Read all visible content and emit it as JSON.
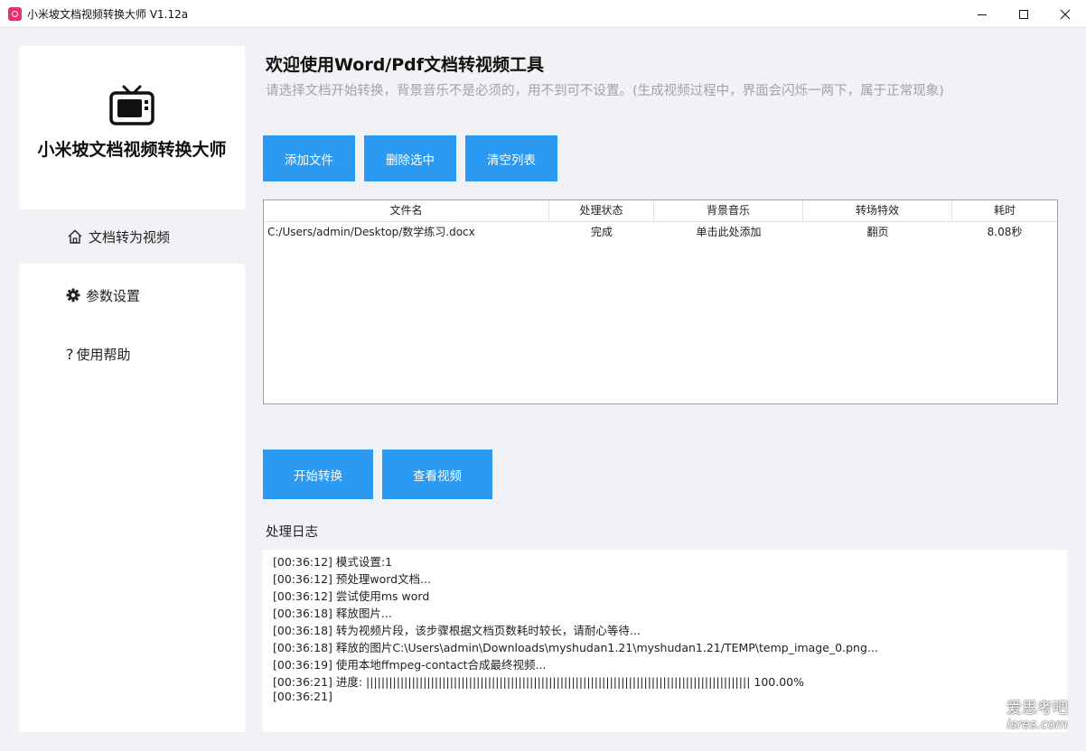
{
  "window": {
    "title": "小米坡文档视频转换大师 V1.12a"
  },
  "sidebar": {
    "app_name": "小米坡文档视频转换大师",
    "items": [
      {
        "label": "文档转为视频",
        "icon": "home-icon",
        "active": true
      },
      {
        "label": "参数设置",
        "icon": "gear-icon",
        "active": false
      },
      {
        "label": "使用帮助",
        "icon": "question-icon",
        "active": false
      }
    ]
  },
  "main": {
    "title": "欢迎使用Word/Pdf文档转视频工具",
    "subtitle": "请选择文档开始转换，背景音乐不是必须的，用不到可不设置。(生成视频过程中，界面会闪烁一两下，属于正常现象)",
    "buttons": {
      "add_file": "添加文件",
      "delete_selected": "删除选中",
      "clear_list": "清空列表",
      "start_convert": "开始转换",
      "view_video": "查看视频"
    },
    "table": {
      "headers": [
        "文件名",
        "处理状态",
        "背景音乐",
        "转场特效",
        "耗时"
      ],
      "rows": [
        [
          "C:/Users/admin/Desktop/数学练习.docx",
          "完成",
          "单击此处添加",
          "翻页",
          "8.08秒"
        ]
      ]
    },
    "log": {
      "label": "处理日志",
      "lines": [
        "[00:36:12] 模式设置:1",
        "[00:36:12] 预处理word文档...",
        "[00:36:12] 尝试使用ms word",
        "[00:36:18] 释放图片...",
        "[00:36:18] 转为视频片段，该步骤根据文档页数耗时较长，请耐心等待...",
        "[00:36:18] 释放的图片C:\\Users\\admin\\Downloads\\myshudan1.21\\myshudan1.21/TEMP\\temp_image_0.png...",
        "[00:36:19] 使用本地ffmpeg-contact合成最终视频...",
        "[00:36:21] 进度: ||||||||||||||||||||||||||||||||||||||||||||||||||||||||||||||||||||||||||||||||||||||||||||||||||||| 100.00%",
        "[00:36:21]"
      ]
    }
  },
  "watermark": {
    "line1": "爱思考吧",
    "line2": "isres.com"
  },
  "colors": {
    "accent": "#2b9af3",
    "background": "#f0f2f5",
    "panel": "#ffffff",
    "subtitle": "#a3a3a3"
  }
}
